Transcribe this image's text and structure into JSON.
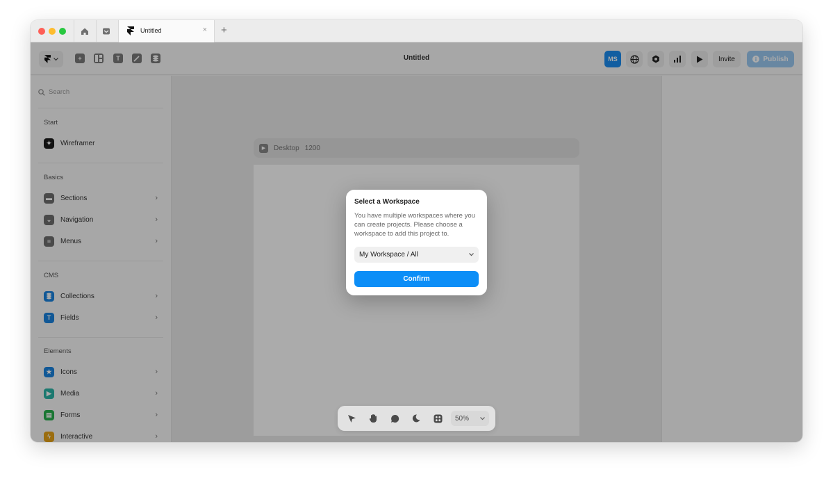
{
  "tab": {
    "title": "Untitled",
    "close": "×",
    "new_tab": "+"
  },
  "toolbar": {
    "document_title": "Untitled",
    "avatar_initials": "MS",
    "invite_label": "Invite",
    "publish_label": "Publish"
  },
  "sidebar": {
    "search_placeholder": "Search",
    "sections": {
      "start": "Start",
      "basics": "Basics",
      "cms": "CMS",
      "elements": "Elements"
    },
    "items": {
      "wireframer": "Wireframer",
      "sections": "Sections",
      "navigation": "Navigation",
      "menus": "Menus",
      "collections": "Collections",
      "fields": "Fields",
      "icons": "Icons",
      "media": "Media",
      "forms": "Forms",
      "interactive": "Interactive"
    }
  },
  "canvas": {
    "frame_name": "Desktop",
    "frame_width": "1200"
  },
  "bottombar": {
    "zoom": "50%"
  },
  "modal": {
    "title": "Select a Workspace",
    "body": "You have multiple workspaces where you can create projects. Please choose a workspace to add this project to.",
    "workspace_selected": "My Workspace / All",
    "confirm_label": "Confirm"
  },
  "colors": {
    "accent": "#0c8ef7",
    "avatar": "#1b8df0",
    "publish_disabled": "#9cc9f2",
    "icon_blue": "#1a84e0",
    "icon_teal": "#2bb5a8",
    "icon_green": "#27b04d",
    "icon_amber": "#e8a317"
  },
  "icons": [
    "home-icon",
    "inbox-icon",
    "framer-logo-icon",
    "plus-icon",
    "grid-icon",
    "text-icon",
    "pen-icon",
    "layers-icon",
    "globe-icon",
    "settings-icon",
    "chart-icon",
    "play-icon",
    "info-icon",
    "cursor-icon",
    "hand-icon",
    "comment-icon",
    "moon-icon",
    "components-icon",
    "chevron-down-icon",
    "chevron-right-icon",
    "search-icon"
  ]
}
